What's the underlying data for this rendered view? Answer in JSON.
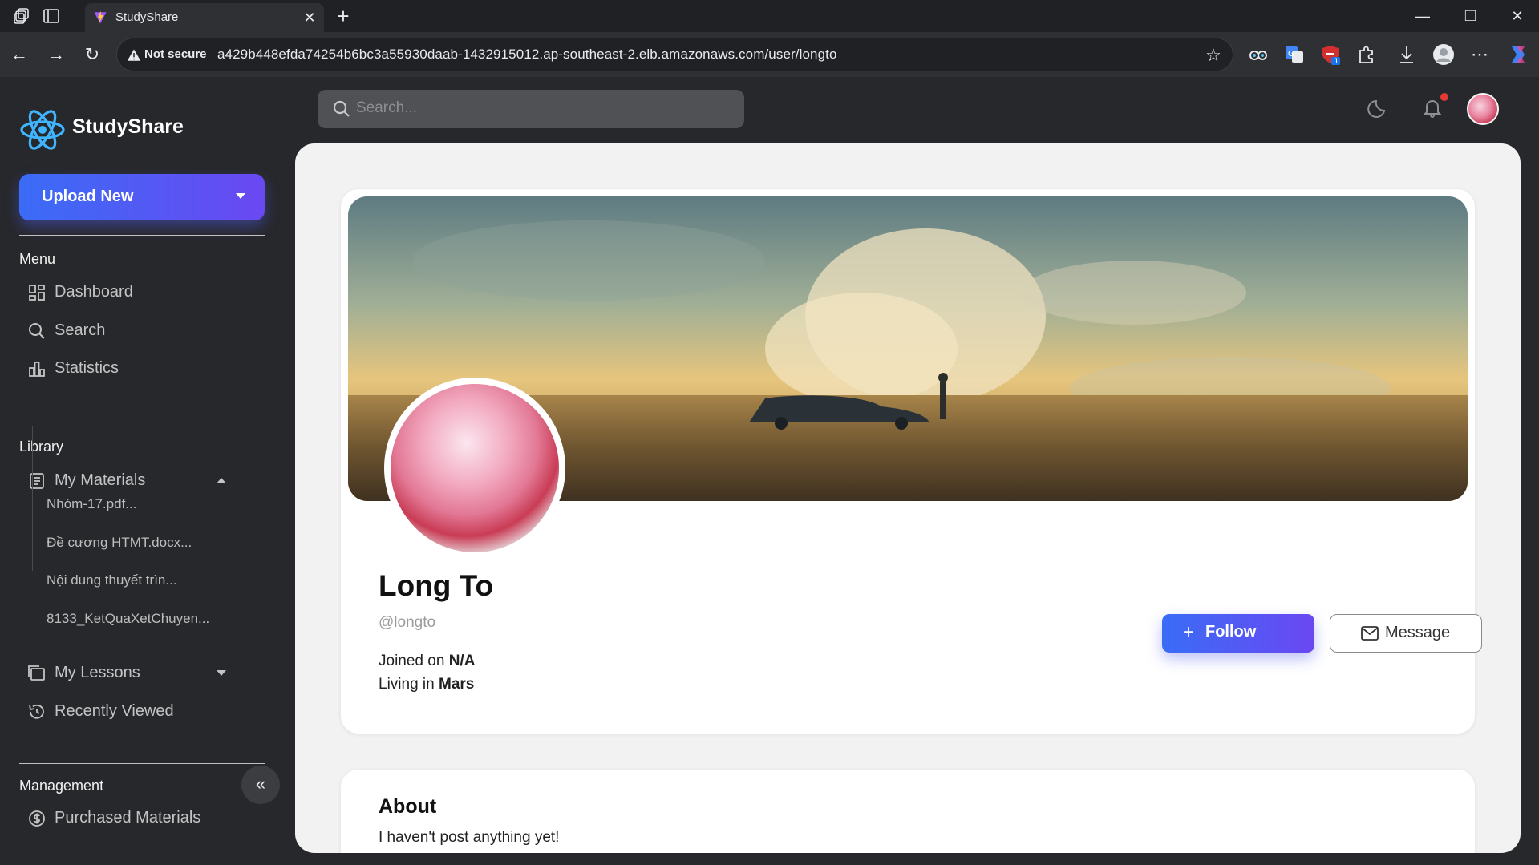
{
  "browser": {
    "tab_title": "StudyShare",
    "not_secure_label": "Not secure",
    "url": "a429b448efda74254b6bc3a55930daab-1432915012.ap-southeast-2.elb.amazonaws.com/user/longto",
    "extension_badge": "1"
  },
  "sidebar": {
    "brand": "StudyShare",
    "upload_label": "Upload New",
    "menu_title": "Menu",
    "menu_items": [
      {
        "label": "Dashboard",
        "icon": "dashboard-icon"
      },
      {
        "label": "Search",
        "icon": "search-icon"
      },
      {
        "label": "Statistics",
        "icon": "statistics-icon"
      }
    ],
    "library_title": "Library",
    "my_materials_label": "My Materials",
    "materials": [
      "Nhóm-17.pdf...",
      "Đề cương HTMT.docx...",
      "Nội dung thuyết trìn...",
      "8133_KetQuaXetChuyen..."
    ],
    "my_lessons_label": "My Lessons",
    "recently_viewed_label": "Recently Viewed",
    "management_title": "Management",
    "purchased_label": "Purchased Materials",
    "collapse_glyph": "«"
  },
  "header": {
    "search_placeholder": "Search..."
  },
  "profile": {
    "name": "Long To",
    "handle": "@longto",
    "joined_prefix": "Joined on ",
    "joined_value": "N/A",
    "living_prefix": "Living in ",
    "living_value": "Mars",
    "follow_label": "Follow",
    "message_label": "Message"
  },
  "about": {
    "title": "About",
    "text": "I haven't post anything yet!"
  },
  "colors": {
    "accent_start": "#3a6cf6",
    "accent_end": "#6a48f2",
    "logo": "#3fb4ff",
    "sidebar_bg": "#27282b"
  }
}
